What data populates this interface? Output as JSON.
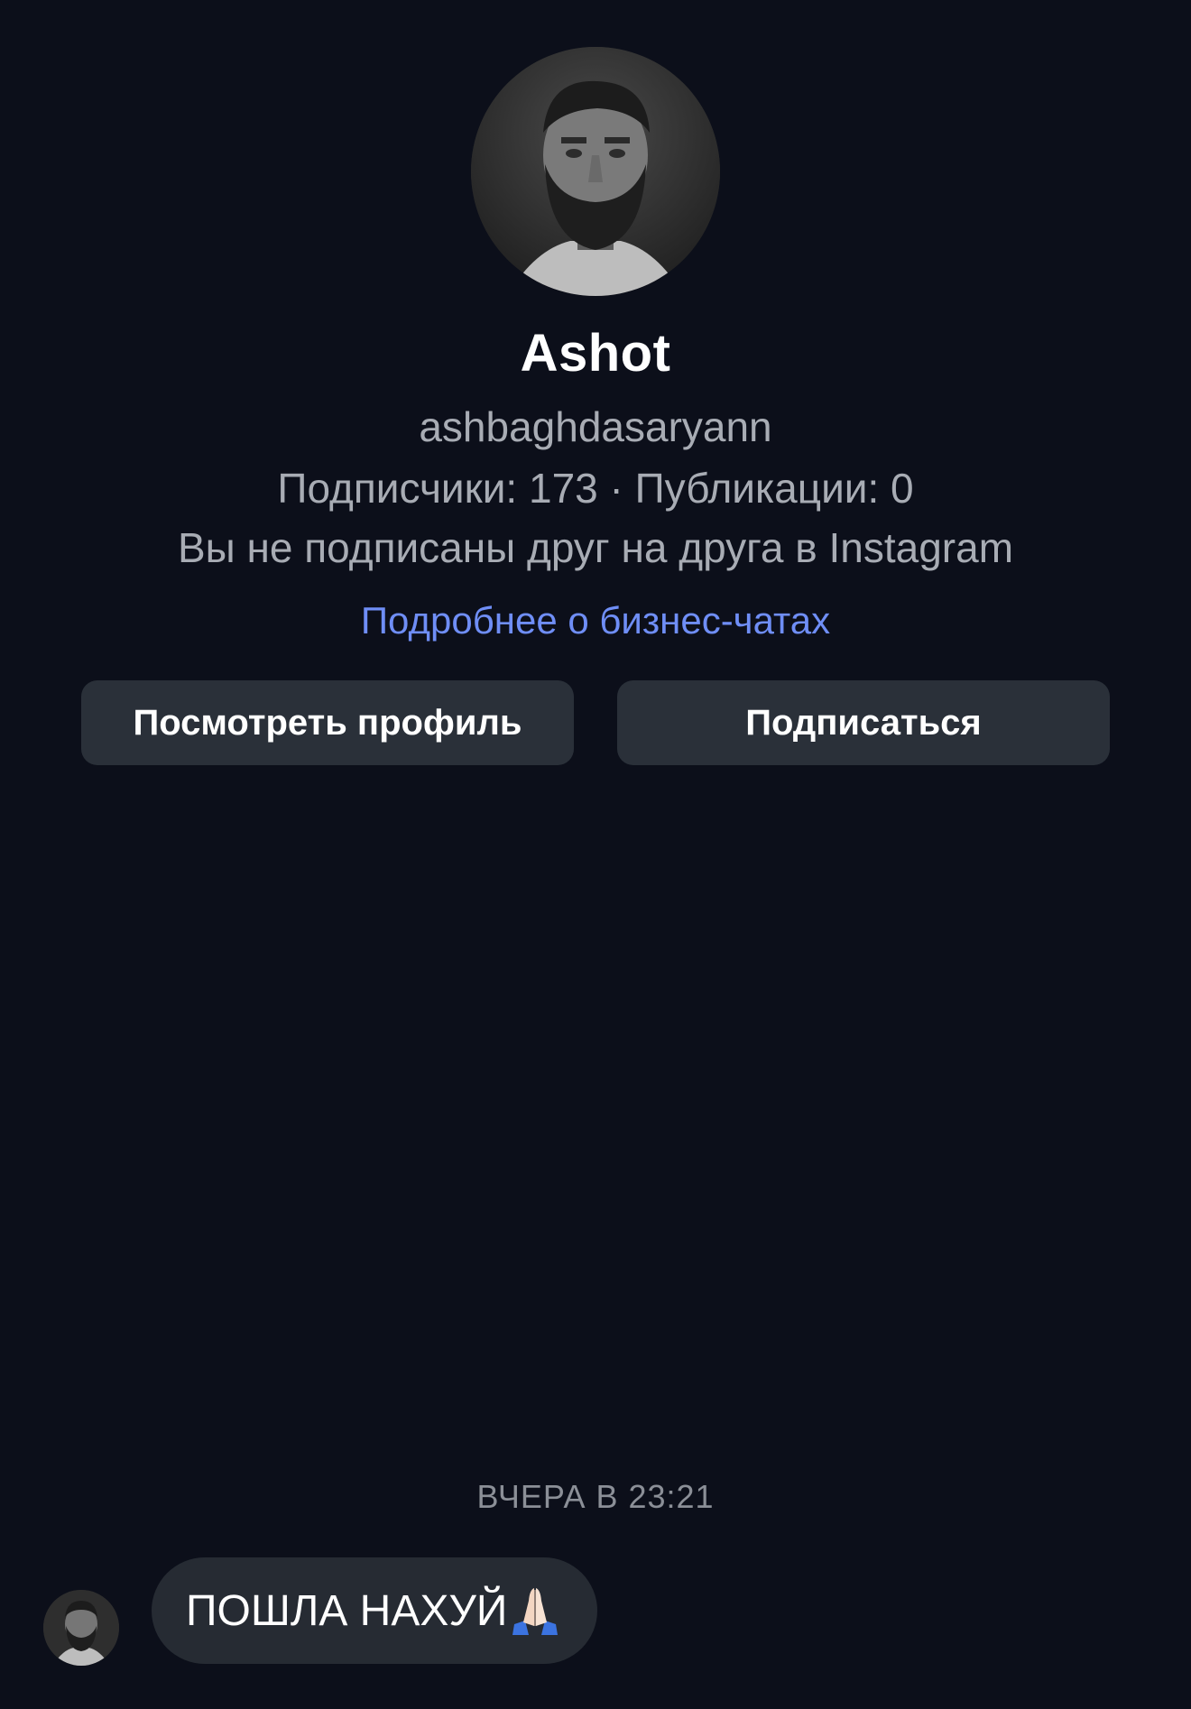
{
  "profile": {
    "avatar_icon": "user-photo",
    "display_name": "Ashot",
    "username": "ashbaghdasaryann",
    "stats": "Подписчики: 173 · Публикации: 0",
    "follow_status": "Вы не подписаны друг на друга в Instagram",
    "business_link": "Подробнее о бизнес-чатах"
  },
  "actions": {
    "view_profile_label": "Посмотреть профиль",
    "follow_label": "Подписаться"
  },
  "chat": {
    "timestamp": "ВЧЕРА В 23:21",
    "messages": [
      {
        "text": "ПОШЛА НАХУЙ",
        "emoji_icon": "folded-hands-icon"
      }
    ]
  },
  "colors": {
    "background": "#0c0f1a",
    "button": "#2a3039",
    "bubble": "#262b33",
    "link": "#6f8ef6",
    "secondary_text": "#a8acb4"
  }
}
